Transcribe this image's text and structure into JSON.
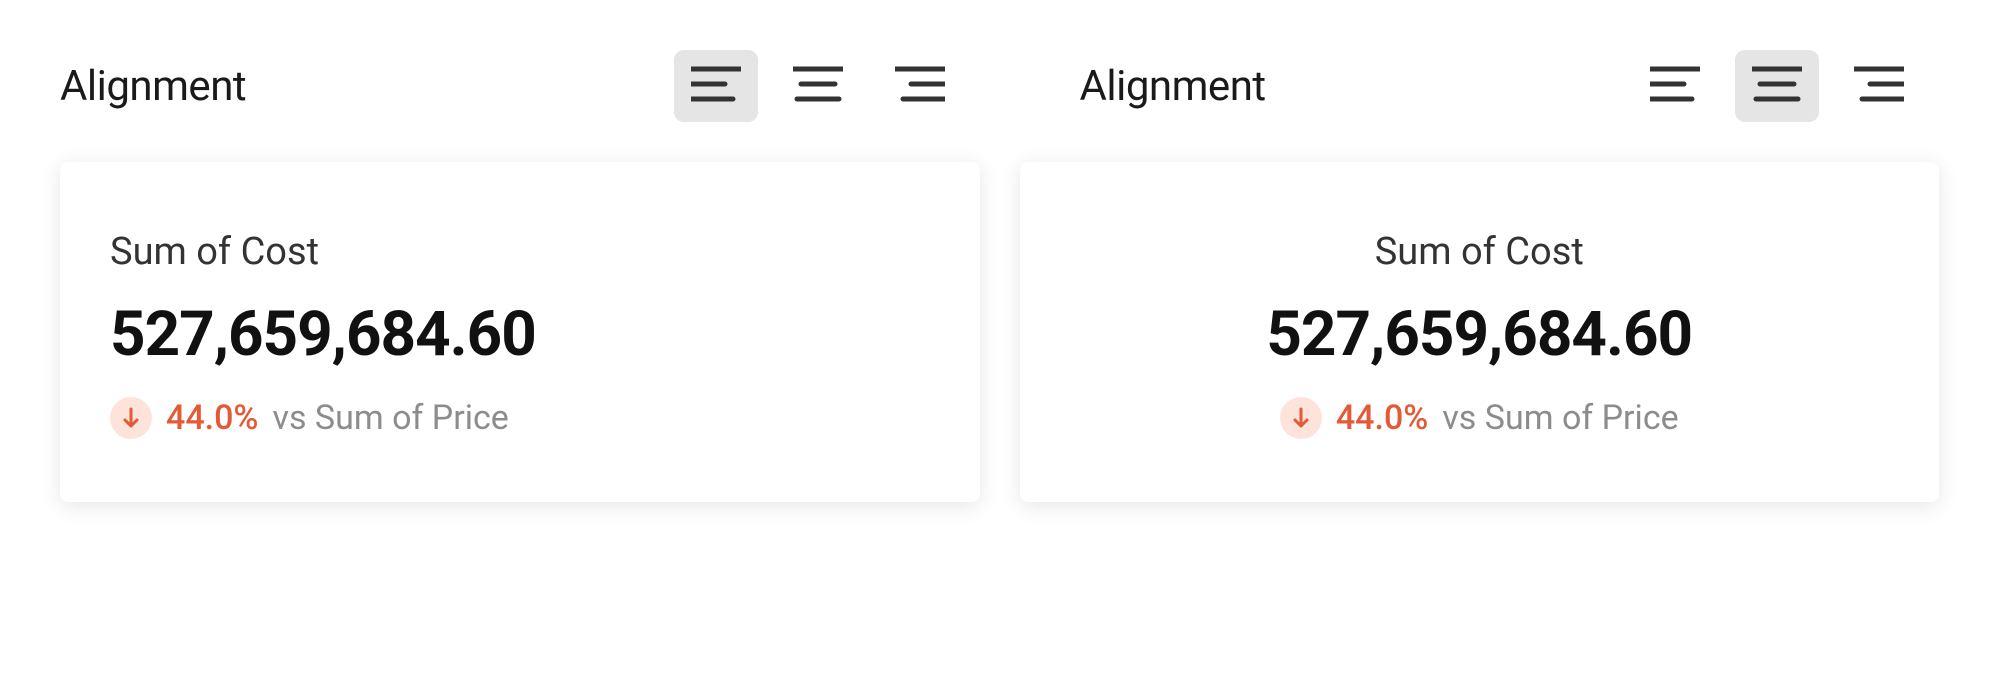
{
  "panels": [
    {
      "label": "Alignment",
      "selected": "left",
      "card": {
        "title": "Sum of Cost",
        "value": "527,659,684.60",
        "delta_pct": "44.0%",
        "delta_compare": "vs Sum of Price",
        "direction": "down"
      }
    },
    {
      "label": "Alignment",
      "selected": "center",
      "card": {
        "title": "Sum of Cost",
        "value": "527,659,684.60",
        "delta_pct": "44.0%",
        "delta_compare": "vs Sum of Price",
        "direction": "down"
      }
    }
  ],
  "colors": {
    "delta": "#e35a36",
    "delta_bg": "#fde3da"
  }
}
